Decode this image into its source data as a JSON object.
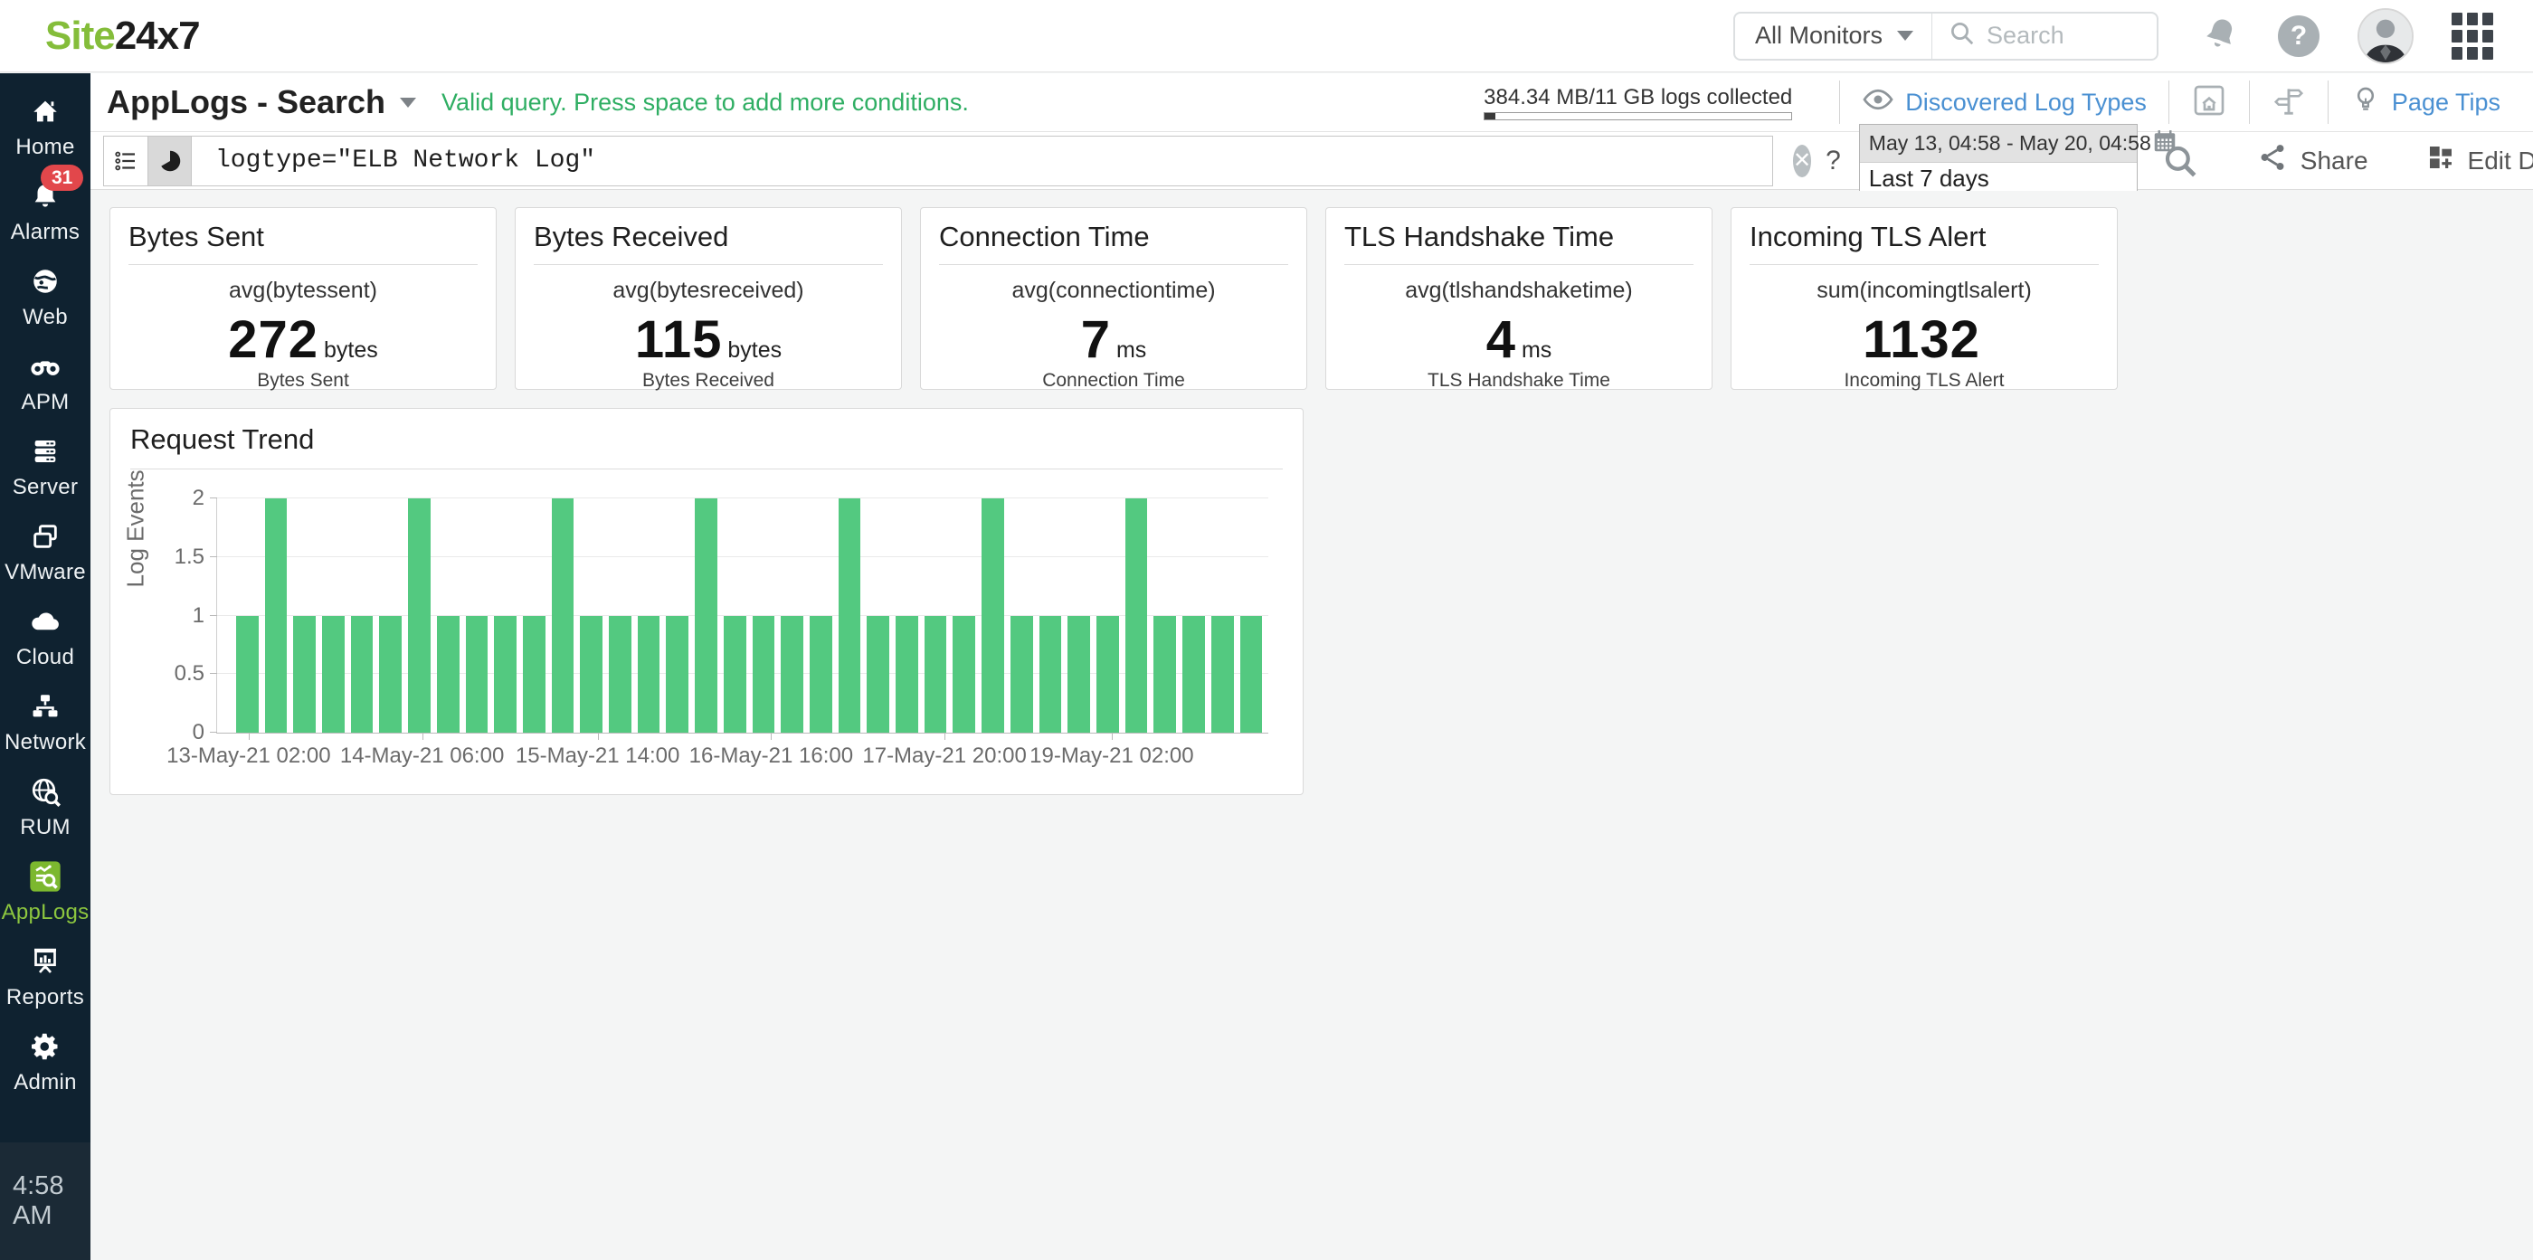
{
  "topbar": {
    "logo_part1": "Site",
    "logo_part2": "24x7",
    "monitor_dropdown": "All Monitors",
    "search_placeholder": "Search"
  },
  "sidebar": {
    "items": [
      {
        "id": "home",
        "label": "Home",
        "icon": "home-icon"
      },
      {
        "id": "alarms",
        "label": "Alarms",
        "icon": "bell-icon",
        "badge": "31"
      },
      {
        "id": "web",
        "label": "Web",
        "icon": "globe-icon"
      },
      {
        "id": "apm",
        "label": "APM",
        "icon": "binoculars-icon"
      },
      {
        "id": "server",
        "label": "Server",
        "icon": "server-icon"
      },
      {
        "id": "vmware",
        "label": "VMware",
        "icon": "vmware-icon"
      },
      {
        "id": "cloud",
        "label": "Cloud",
        "icon": "cloud-icon"
      },
      {
        "id": "network",
        "label": "Network",
        "icon": "network-icon"
      },
      {
        "id": "rum",
        "label": "RUM",
        "icon": "rum-icon"
      },
      {
        "id": "applogs",
        "label": "AppLogs",
        "icon": "applogs-icon",
        "active": true
      },
      {
        "id": "reports",
        "label": "Reports",
        "icon": "reports-icon"
      },
      {
        "id": "admin",
        "label": "Admin",
        "icon": "gear-icon"
      }
    ],
    "time": "4:58 AM"
  },
  "header": {
    "title": "AppLogs - Search",
    "status_message": "Valid query. Press space to add more conditions.",
    "usage_text": "384.34 MB/11 GB logs collected",
    "usage_percent": 3.4,
    "discovered_link": "Discovered Log Types",
    "page_tips_link": "Page Tips"
  },
  "querybar": {
    "query": "logtype=\"ELB Network Log\"",
    "clear_symbol": "✕",
    "help_symbol": "?",
    "date_range": "May 13, 04:58 - May 20, 04:58",
    "date_preset": "Last 7 days",
    "share_label": "Share",
    "edit_dashboard_label": "Edit Dashboard"
  },
  "cards": [
    {
      "title": "Bytes Sent",
      "metric": "avg(bytessent)",
      "value": "272",
      "unit": "bytes",
      "caption": "Bytes Sent"
    },
    {
      "title": "Bytes Received",
      "metric": "avg(bytesreceived)",
      "value": "115",
      "unit": "bytes",
      "caption": "Bytes Received"
    },
    {
      "title": "Connection Time",
      "metric": "avg(connectiontime)",
      "value": "7",
      "unit": "ms",
      "caption": "Connection Time"
    },
    {
      "title": "TLS Handshake Time",
      "metric": "avg(tlshandshaketime)",
      "value": "4",
      "unit": "ms",
      "caption": "TLS Handshake Time"
    },
    {
      "title": "Incoming TLS Alert",
      "metric": "sum(incomingtlsalert)",
      "value": "1132",
      "unit": "",
      "caption": "Incoming TLS Alert"
    }
  ],
  "chart_data": {
    "type": "bar",
    "title": "Request Trend",
    "xlabel": "",
    "ylabel": "Log Events",
    "ylim": [
      0,
      2
    ],
    "yticks": [
      0,
      0.5,
      1,
      1.5,
      2
    ],
    "grid": true,
    "legend": false,
    "bar_color": "#53c980",
    "x_tick_labels": [
      "13-May-21 02:00",
      "14-May-21 06:00",
      "15-May-21 14:00",
      "16-May-21 16:00",
      "17-May-21 20:00",
      "19-May-21 02:00"
    ],
    "x_tick_positions_pct": [
      3.0,
      19.5,
      36.2,
      52.7,
      69.2,
      85.1
    ],
    "values": [
      1,
      2,
      1,
      1,
      1,
      1,
      2,
      1,
      1,
      1,
      1,
      2,
      1,
      1,
      1,
      1,
      2,
      1,
      1,
      1,
      1,
      2,
      1,
      1,
      1,
      1,
      2,
      1,
      1,
      1,
      1,
      2,
      1,
      1,
      1,
      1
    ]
  },
  "colors": {
    "brand_green": "#84bd3a",
    "active_green": "#8cc63f",
    "status_green": "#2fae63",
    "bar_green": "#53c980",
    "link_blue": "#4a90d2",
    "sidebar_bg": "#0f2230",
    "badge_red": "#e2474b",
    "content_bg": "#f4f5f5"
  }
}
